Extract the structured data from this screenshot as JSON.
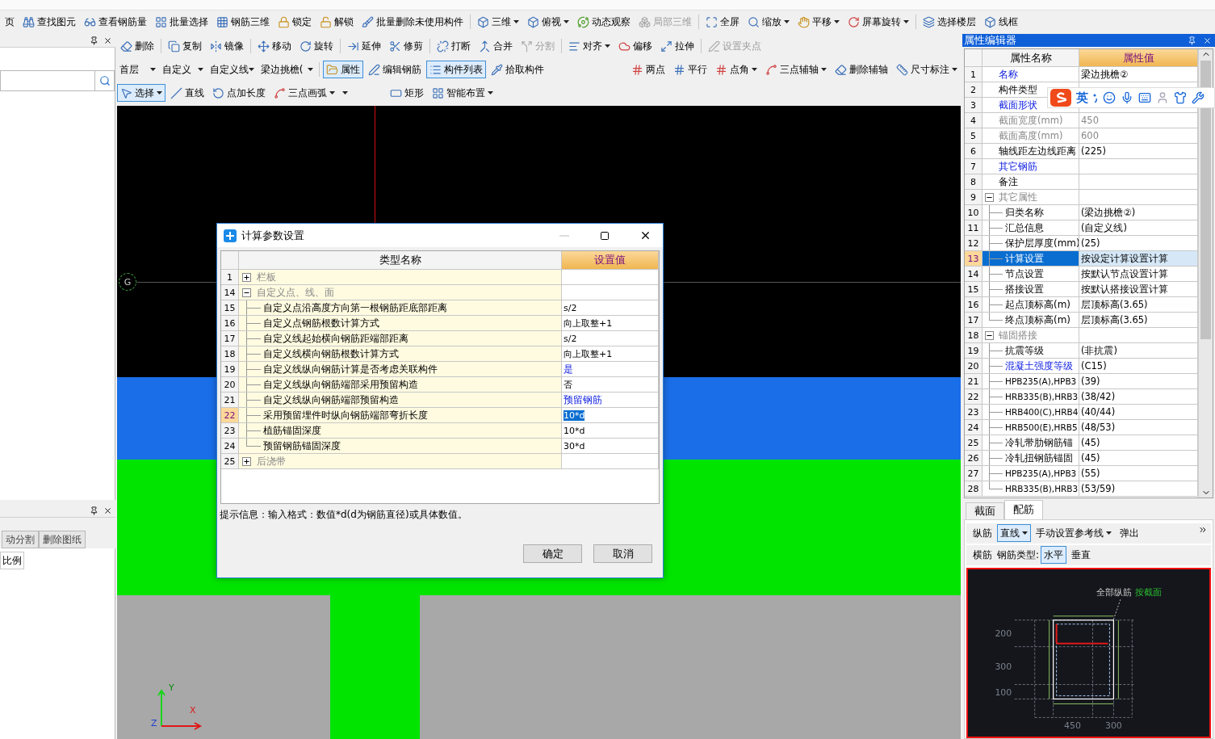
{
  "main_toolbar": [
    {
      "label": "页",
      "dropdown": false,
      "disabled": false
    },
    {
      "label": "查找图元",
      "dropdown": false,
      "disabled": false
    },
    {
      "label": "查看钢筋量",
      "dropdown": false,
      "disabled": false
    },
    {
      "label": "批量选择",
      "dropdown": false,
      "disabled": false
    },
    {
      "label": "钢筋三维",
      "dropdown": false,
      "disabled": false
    },
    {
      "label": "锁定",
      "dropdown": false,
      "disabled": false
    },
    {
      "label": "解锁",
      "dropdown": false,
      "disabled": false
    },
    {
      "label": "批量删除未使用构件",
      "dropdown": false,
      "disabled": false
    },
    {
      "label": "三维",
      "dropdown": true,
      "disabled": false
    },
    {
      "label": "俯视",
      "dropdown": true,
      "disabled": false
    },
    {
      "label": "动态观察",
      "dropdown": false,
      "disabled": false
    },
    {
      "label": "局部三维",
      "dropdown": false,
      "disabled": true
    },
    {
      "label": "全屏",
      "dropdown": false,
      "disabled": false
    },
    {
      "label": "缩放",
      "dropdown": true,
      "disabled": false
    },
    {
      "label": "平移",
      "dropdown": true,
      "disabled": false
    },
    {
      "label": "屏幕旋转",
      "dropdown": true,
      "disabled": false
    },
    {
      "label": "选择楼层",
      "dropdown": false,
      "disabled": false
    },
    {
      "label": "线框",
      "dropdown": false,
      "disabled": false
    }
  ],
  "left_panel": {
    "lower_tabs": [
      {
        "label": "动分割",
        "selected": false
      },
      {
        "label": "删除图纸",
        "selected": false
      }
    ],
    "column_header": "比例"
  },
  "edit_toolbar": [
    {
      "label": "删除",
      "dropdown": false,
      "disabled": false
    },
    {
      "label": "复制",
      "dropdown": false,
      "disabled": false
    },
    {
      "label": "镜像",
      "dropdown": false,
      "disabled": false
    },
    {
      "label": "移动",
      "dropdown": false,
      "disabled": false
    },
    {
      "label": "旋转",
      "dropdown": false,
      "disabled": false
    },
    {
      "label": "延伸",
      "dropdown": false,
      "disabled": false
    },
    {
      "label": "修剪",
      "dropdown": false,
      "disabled": false
    },
    {
      "label": "打断",
      "dropdown": false,
      "disabled": false
    },
    {
      "label": "合并",
      "dropdown": false,
      "disabled": false
    },
    {
      "label": "分割",
      "dropdown": false,
      "disabled": true
    },
    {
      "label": "对齐",
      "dropdown": true,
      "disabled": false
    },
    {
      "label": "偏移",
      "dropdown": false,
      "disabled": false
    },
    {
      "label": "拉伸",
      "dropdown": false,
      "disabled": false
    },
    {
      "label": "设置夹点",
      "dropdown": false,
      "disabled": true
    }
  ],
  "layer_selects": [
    {
      "value": "首层"
    },
    {
      "value": "自定义"
    },
    {
      "value": "自定义线"
    },
    {
      "value": "梁边挑檐("
    }
  ],
  "view_buttons": [
    {
      "label": "属性",
      "pressed": true
    },
    {
      "label": "编辑钢筋",
      "pressed": false
    },
    {
      "label": "构件列表",
      "pressed": true
    },
    {
      "label": "拾取构件",
      "pressed": false
    }
  ],
  "axis_toolbar": [
    {
      "label": "两点",
      "dropdown": false,
      "disabled": false
    },
    {
      "label": "平行",
      "dropdown": false,
      "disabled": false
    },
    {
      "label": "点角",
      "dropdown": true,
      "disabled": false
    },
    {
      "label": "三点辅轴",
      "dropdown": true,
      "disabled": false
    },
    {
      "label": "删除辅轴",
      "dropdown": false,
      "disabled": false
    },
    {
      "label": "尺寸标注",
      "dropdown": true,
      "disabled": false
    }
  ],
  "draw_toolbar": [
    {
      "kind": "button",
      "label": "选择",
      "dropdown": true,
      "pressed": true
    },
    {
      "kind": "button",
      "label": "直线",
      "dropdown": false,
      "pressed": false
    },
    {
      "kind": "button",
      "label": "点加长度",
      "dropdown": false,
      "pressed": false
    },
    {
      "kind": "button",
      "label": "三点画弧",
      "dropdown": true,
      "pressed": false
    },
    {
      "kind": "select",
      "dropdown": true
    },
    {
      "kind": "button",
      "label": "矩形",
      "dropdown": false,
      "pressed": false
    },
    {
      "kind": "button",
      "label": "智能布置",
      "dropdown": true,
      "pressed": false
    }
  ],
  "canvas": {
    "axis_label": "G",
    "axes": [
      "Y",
      "X",
      "Z"
    ]
  },
  "dialog": {
    "title": "计算参数设置",
    "columns": [
      "类型名称",
      "设置值"
    ],
    "rows": [
      {
        "kind": "group",
        "num": "1",
        "name": "栏板",
        "expanded": false,
        "selected": false
      },
      {
        "kind": "group",
        "num": "14",
        "name": "自定义点、线、面",
        "expanded": true,
        "selected": false,
        "children": [
          {
            "kind": "item",
            "num": "15",
            "name": "自定义点沿高度方向第一根钢筋距底部距离",
            "value": "s/2",
            "link": false,
            "selected": false
          },
          {
            "kind": "item",
            "num": "16",
            "name": "自定义点钢筋根数计算方式",
            "value": "向上取整+1",
            "link": false,
            "selected": false
          },
          {
            "kind": "item",
            "num": "17",
            "name": "自定义线起始横向钢筋距端部距离",
            "value": "s/2",
            "link": false,
            "selected": false
          },
          {
            "kind": "item",
            "num": "18",
            "name": "自定义线横向钢筋根数计算方式",
            "value": "向上取整+1",
            "link": false,
            "selected": false
          },
          {
            "kind": "item",
            "num": "19",
            "name": "自定义线纵向钢筋计算是否考虑关联构件",
            "value": "是",
            "link": true,
            "selected": false
          },
          {
            "kind": "item",
            "num": "20",
            "name": "自定义线纵向钢筋端部采用预留构造",
            "value": "否",
            "link": false,
            "selected": false
          },
          {
            "kind": "item",
            "num": "21",
            "name": "自定义线纵向钢筋端部预留构造",
            "value": "预留钢筋",
            "link": true,
            "selected": false
          },
          {
            "kind": "item",
            "num": "22",
            "name": "采用预留埋件时纵向钢筋端部弯折长度",
            "value": "10*d",
            "link": false,
            "selected": true
          },
          {
            "kind": "item",
            "num": "23",
            "name": "植筋锚固深度",
            "value": "10*d",
            "link": false,
            "selected": false
          },
          {
            "kind": "item",
            "num": "24",
            "name": "预留钢筋锚固深度",
            "value": "30*d",
            "link": false,
            "selected": false
          }
        ]
      },
      {
        "kind": "group",
        "num": "25",
        "name": "后浇带",
        "expanded": false,
        "selected": false
      }
    ],
    "hint": "提示信息：输入格式：数值*d(d为钢筋直径)或具体数值。",
    "buttons": [
      "确定",
      "取消"
    ]
  },
  "property_editor": {
    "title": "属性编辑器",
    "columns": [
      "属性名称",
      "属性值"
    ],
    "rows": [
      {
        "kind": "item",
        "num": "1",
        "name": "名称",
        "link": true,
        "disabled": false,
        "value": "梁边挑檐②",
        "selected": false
      },
      {
        "kind": "item",
        "num": "2",
        "name": "构件类型",
        "link": false,
        "disabled": false,
        "selected": false
      },
      {
        "kind": "item",
        "num": "3",
        "name": "截面形状",
        "link": true,
        "disabled": false,
        "selected": false
      },
      {
        "kind": "item",
        "num": "4",
        "name": "截面宽度(mm)",
        "link": false,
        "disabled": true,
        "value": "450",
        "selected": false
      },
      {
        "kind": "item",
        "num": "5",
        "name": "截面高度(mm)",
        "link": false,
        "disabled": true,
        "value": "600",
        "selected": false
      },
      {
        "kind": "item",
        "num": "6",
        "name": "轴线距左边线距离",
        "link": false,
        "disabled": false,
        "value": "(225)",
        "selected": false
      },
      {
        "kind": "item",
        "num": "7",
        "name": "其它钢筋",
        "link": true,
        "disabled": false,
        "selected": false
      },
      {
        "kind": "item",
        "num": "8",
        "name": "备注",
        "link": false,
        "disabled": false,
        "selected": false
      },
      {
        "kind": "group",
        "num": "9",
        "name": "其它属性",
        "expanded": true,
        "selected": false,
        "children": [
          {
            "kind": "item",
            "num": "10",
            "name": "归类名称",
            "link": false,
            "disabled": false,
            "value": "(梁边挑檐②)",
            "selected": false
          },
          {
            "kind": "item",
            "num": "11",
            "name": "汇总信息",
            "link": false,
            "disabled": false,
            "value": "(自定义线)",
            "selected": false
          },
          {
            "kind": "item",
            "num": "12",
            "name": "保护层厚度(mm)",
            "link": false,
            "disabled": false,
            "value": "(25)",
            "selected": false
          },
          {
            "kind": "item",
            "num": "13",
            "name": "计算设置",
            "link": false,
            "disabled": false,
            "value": "按设定计算设置计算",
            "selected": true
          },
          {
            "kind": "item",
            "num": "14",
            "name": "节点设置",
            "link": false,
            "disabled": false,
            "value": "按默认节点设置计算",
            "selected": false
          },
          {
            "kind": "item",
            "num": "15",
            "name": "搭接设置",
            "link": false,
            "disabled": false,
            "value": "按默认搭接设置计算",
            "selected": false
          },
          {
            "kind": "item",
            "num": "16",
            "name": "起点顶标高(m)",
            "link": false,
            "disabled": false,
            "value": "层顶标高(3.65)",
            "selected": false
          },
          {
            "kind": "item",
            "num": "17",
            "name": "终点顶标高(m)",
            "link": false,
            "disabled": false,
            "value": "层顶标高(3.65)",
            "selected": false
          }
        ]
      },
      {
        "kind": "group",
        "num": "18",
        "name": "锚固搭接",
        "expanded": true,
        "selected": false,
        "children": [
          {
            "kind": "item",
            "num": "19",
            "name": "抗震等级",
            "link": false,
            "disabled": false,
            "value": "(非抗震)",
            "selected": false
          },
          {
            "kind": "item",
            "num": "20",
            "name": "混凝土强度等级",
            "link": true,
            "disabled": false,
            "value": "(C15)",
            "selected": false
          },
          {
            "kind": "item",
            "num": "21",
            "name": "HPB235(A),HPB3",
            "link": false,
            "disabled": false,
            "value": "(39)",
            "selected": false
          },
          {
            "kind": "item",
            "num": "22",
            "name": "HRB335(B),HRB3",
            "link": false,
            "disabled": false,
            "value": "(38/42)",
            "selected": false
          },
          {
            "kind": "item",
            "num": "23",
            "name": "HRB400(C),HRB4",
            "link": false,
            "disabled": false,
            "value": "(40/44)",
            "selected": false
          },
          {
            "kind": "item",
            "num": "24",
            "name": "HRB500(E),HRB5",
            "link": false,
            "disabled": false,
            "value": "(48/53)",
            "selected": false
          },
          {
            "kind": "item",
            "num": "25",
            "name": "冷轧带肋钢筋锚",
            "link": false,
            "disabled": false,
            "value": "(45)",
            "selected": false
          },
          {
            "kind": "item",
            "num": "26",
            "name": "冷轧扭钢筋锚固",
            "link": false,
            "disabled": false,
            "value": "(45)",
            "selected": false
          },
          {
            "kind": "item",
            "num": "27",
            "name": "HPB235(A),HPB3",
            "link": false,
            "disabled": false,
            "value": "(55)",
            "selected": false
          },
          {
            "kind": "item",
            "num": "28",
            "name": "HRB335(B),HRB3",
            "link": false,
            "disabled": false,
            "value": "(53/59)",
            "selected": false
          }
        ]
      }
    ]
  },
  "ime_bar": {
    "mode": "英"
  },
  "bottom_tabs": [
    {
      "label": "截面",
      "selected": false
    },
    {
      "label": "配筋",
      "selected": true
    }
  ],
  "rebar_toolbar": [
    [
      {
        "kind": "button",
        "label": "纵筋",
        "dropdown": false,
        "pressed": false
      },
      {
        "kind": "button",
        "label": "直线",
        "dropdown": true,
        "pressed": true
      },
      {
        "kind": "button",
        "label": "手动设置参考线",
        "dropdown": true,
        "pressed": false
      },
      {
        "kind": "button",
        "label": "弹出",
        "dropdown": false,
        "pressed": false
      }
    ],
    [
      {
        "kind": "button",
        "label": "横筋",
        "dropdown": false,
        "pressed": false
      },
      {
        "kind": "label",
        "label": "钢筋类型:"
      },
      {
        "kind": "button",
        "label": "水平",
        "dropdown": false,
        "pressed": true
      },
      {
        "kind": "button",
        "label": "垂直",
        "dropdown": false,
        "pressed": false
      }
    ]
  ],
  "section_drawing": {
    "row_labels": [
      "200",
      "300",
      "100"
    ],
    "column_labels": [
      "450",
      "300"
    ],
    "callout": "全部纵筋",
    "callout_link": "按截面"
  }
}
